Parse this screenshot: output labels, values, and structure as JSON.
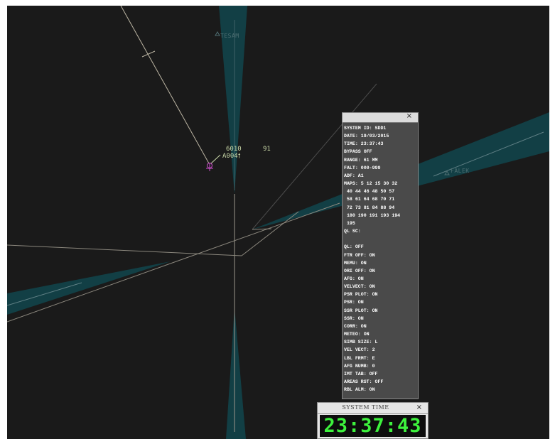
{
  "waypoints": [
    {
      "name": "TESAM"
    },
    {
      "name": "FALEK"
    }
  ],
  "track": {
    "squawk": "6010",
    "callsign": "A004",
    "climb_icon": "arrow-up-icon",
    "value": "91"
  },
  "info_panel": {
    "close_label": "×",
    "lines": [
      "SYSTEM ID: SDD1",
      "DATE: 19/03/2015",
      "TIME: 23:37:43",
      "BYPASS OFF",
      "RANGE: 61 MM",
      "FALT: 000-999",
      "ADF: A1",
      "MAPS: 5 12 15 30 32",
      " 40 44 46 48 50 57",
      " 58 61 64 68 70 71",
      " 72 73 81 84 88 94",
      " 180 190 191 193 194",
      " 195",
      "QL SC:",
      "",
      "QL: OFF",
      "FTR OFF: ON",
      "MEMU: ON",
      "ORI OFF: ON",
      "AFG: ON",
      "VELVECT: ON",
      "PSR PLOT: ON",
      "PSR: ON",
      "SSR PLOT: ON",
      "SSR: ON",
      "CORR: ON",
      "METEO: ON",
      "SIMB SIZE: L",
      "VEL VECT: 2",
      "LBL FRMT: E",
      "AFG NUMB: 0",
      "IMT TAB: OFF",
      "AREAS RST: OFF",
      "RBL ALM: ON"
    ]
  },
  "time_panel": {
    "title": "SYSTEM TIME",
    "close_label": "×",
    "time": "23:37:43"
  },
  "colors": {
    "background": "#1a1a1a",
    "beam": "#123f45",
    "map_line": "#bdb6a4",
    "target": "#c94fc9",
    "clock_digits": "#3df23d"
  }
}
